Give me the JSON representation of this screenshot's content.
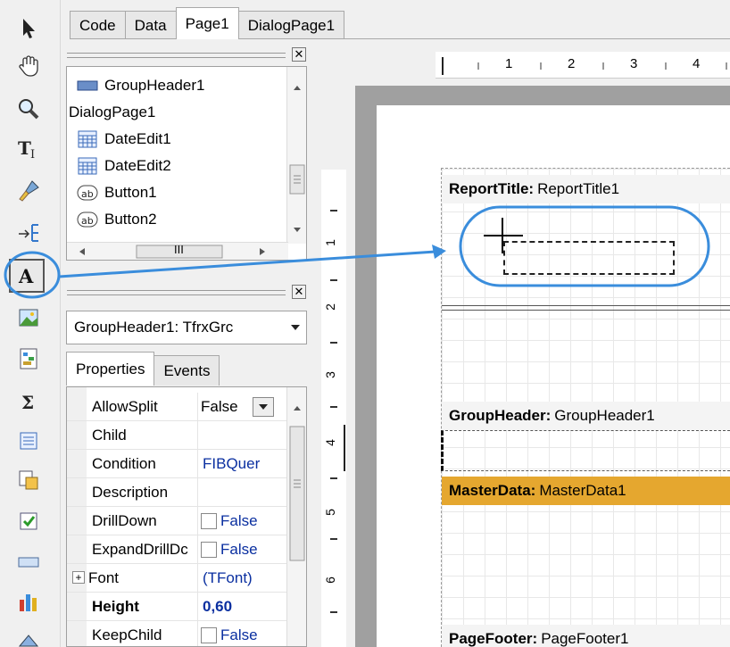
{
  "tabs": [
    "Code",
    "Data",
    "Page1",
    "DialogPage1"
  ],
  "active_tab": "Page1",
  "tree_items": [
    {
      "label": "GroupHeader1",
      "icon": "band-icon"
    },
    {
      "label": "DialogPage1",
      "icon": ""
    },
    {
      "label": "DateEdit1",
      "icon": "calendar-icon"
    },
    {
      "label": "DateEdit2",
      "icon": "calendar-icon"
    },
    {
      "label": "Button1",
      "icon": "ab-button-icon"
    },
    {
      "label": "Button2",
      "icon": "ab-button-icon"
    }
  ],
  "scrollbar_grip": "III",
  "object_combo": "GroupHeader1: TfrxGrc",
  "prop_tabs": [
    "Properties",
    "Events"
  ],
  "properties": [
    {
      "name": "AllowSplit",
      "value": "False",
      "kind": "dropdown"
    },
    {
      "name": "Child",
      "value": "",
      "kind": "text"
    },
    {
      "name": "Condition",
      "value": "FIBQuer",
      "kind": "text"
    },
    {
      "name": "Description",
      "value": "",
      "kind": "text"
    },
    {
      "name": "DrillDown",
      "value": "False",
      "kind": "checkbox"
    },
    {
      "name": "ExpandDrillDᴄ",
      "value": "False",
      "kind": "checkbox"
    },
    {
      "name": "Font",
      "value": "(TFont)",
      "kind": "expand"
    },
    {
      "name": "Height",
      "value": "0,60",
      "kind": "bold"
    },
    {
      "name": "KeepChild",
      "value": "False",
      "kind": "checkbox"
    }
  ],
  "ruler_h": [
    "1",
    "2",
    "3",
    "4"
  ],
  "ruler_v": [
    "1",
    "2",
    "3",
    "4",
    "5",
    "6"
  ],
  "bands": [
    {
      "kind": "ReportTitle:",
      "name": "ReportTitle1"
    },
    {
      "kind": "GroupHeader:",
      "name": "GroupHeader1"
    },
    {
      "kind": "MasterData:",
      "name": "MasterData1"
    },
    {
      "kind": "PageFooter:",
      "name": "PageFooter1"
    }
  ],
  "colors": {
    "highlight": "#3a8ddc",
    "master_band": "#e5a72f",
    "desk": "#a0a0a0"
  },
  "tools": [
    "select-arrow-icon",
    "hand-icon",
    "zoom-icon",
    "text-tool-icon",
    "format-painter-icon",
    "insert-band-icon",
    "text-object-icon",
    "picture-icon",
    "subreport-icon",
    "sum-icon",
    "date-edit-icon",
    "table-icon",
    "checkbox-icon",
    "line-icon",
    "chart-icon",
    "shape-icon"
  ]
}
